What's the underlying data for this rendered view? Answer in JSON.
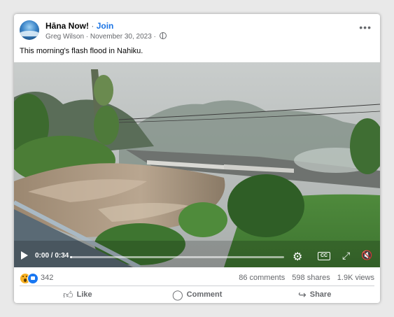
{
  "post": {
    "page_name": "Hāna Now!",
    "separator": "·",
    "join_label": "Join",
    "author": "Greg Wilson",
    "date": "November 30, 2023",
    "meta_sep": "·",
    "more_label": "•••",
    "caption": "This morning's flash flood in Nahiku."
  },
  "video": {
    "time": "0:00 / 0:34",
    "progress": 0.0,
    "cc_label": "CC",
    "icons": [
      "play-icon",
      "settings-icon",
      "cc-icon",
      "fullscreen-icon",
      "mute-icon"
    ]
  },
  "stats": {
    "reaction_count": "342",
    "comments": "86 comments",
    "shares": "598 shares",
    "views": "1.9K views",
    "reaction_icons": [
      "wow-reaction-icon",
      "like-reaction-icon"
    ]
  },
  "actions": {
    "like": "Like",
    "comment": "Comment",
    "share": "Share"
  },
  "colors": {
    "join": "#1b74e4",
    "muted_text": "#65676b",
    "like_blue": "#1877f2"
  }
}
